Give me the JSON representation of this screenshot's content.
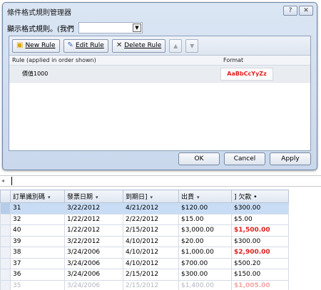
{
  "dialog": {
    "title": "條件格式規則管理器",
    "help_btn": "?",
    "close_btn": "✕",
    "show_rules_label": "顯示格式規則。(我們",
    "show_rules_value": "",
    "toolbar": {
      "new_rule": "New Rule",
      "edit_rule": "Edit Rule",
      "delete_rule": "Delete Rule",
      "move_up": "▲",
      "move_down": "▼"
    },
    "columns": {
      "rule": "Rule (applied in order shown)",
      "format": "Format"
    },
    "rules": [
      {
        "rule": "價值1000",
        "format_sample": "AaBbCcYyZz"
      }
    ],
    "buttons": {
      "ok": "OK",
      "cancel": "Cancel",
      "apply": "Apply"
    }
  },
  "strip": {
    "scroll_left": "◂"
  },
  "datasheet": {
    "columns": [
      "訂單識別碼",
      "發票日期",
      "到期日]",
      "出貨",
      "] 欠款 •"
    ],
    "rows": [
      {
        "id": "31",
        "invoice": "3/22/2012",
        "due": "4/21/2012",
        "ship": "$120.00",
        "owed": "$300.00",
        "neg": false,
        "hl": true,
        "fade": false
      },
      {
        "id": "32",
        "invoice": "1/22/2012",
        "due": "2/22/2012",
        "ship": "$15.00",
        "owed": "$5.00",
        "neg": false,
        "hl": false,
        "fade": false
      },
      {
        "id": "40",
        "invoice": "1/22/2012",
        "due": "2/15/2012",
        "ship": "$3,000.00",
        "owed": "$1,500.00",
        "neg": true,
        "hl": false,
        "fade": false
      },
      {
        "id": "39",
        "invoice": "3/22/2012",
        "due": "4/10/2012",
        "ship": "$20.00",
        "owed": "$300.00",
        "neg": false,
        "hl": false,
        "fade": false
      },
      {
        "id": "38",
        "invoice": "3/24/2006",
        "due": "4/10/2012",
        "ship": "$1,000.00",
        "owed": "$2,900.00",
        "neg": true,
        "hl": false,
        "fade": false
      },
      {
        "id": "37",
        "invoice": "3/24/2006",
        "due": "4/10/2012",
        "ship": "$700.00",
        "owed": "$500.20",
        "neg": false,
        "hl": false,
        "fade": false
      },
      {
        "id": "36",
        "invoice": "3/24/2006",
        "due": "2/15/2012",
        "ship": "$300.00",
        "owed": "$150.00",
        "neg": false,
        "hl": false,
        "fade": false
      },
      {
        "id": "35",
        "invoice": "3/24/2006",
        "due": "2/15/2012",
        "ship": "$1,400.00",
        "owed": "$1,005.00",
        "neg": true,
        "hl": false,
        "fade": true
      }
    ]
  }
}
